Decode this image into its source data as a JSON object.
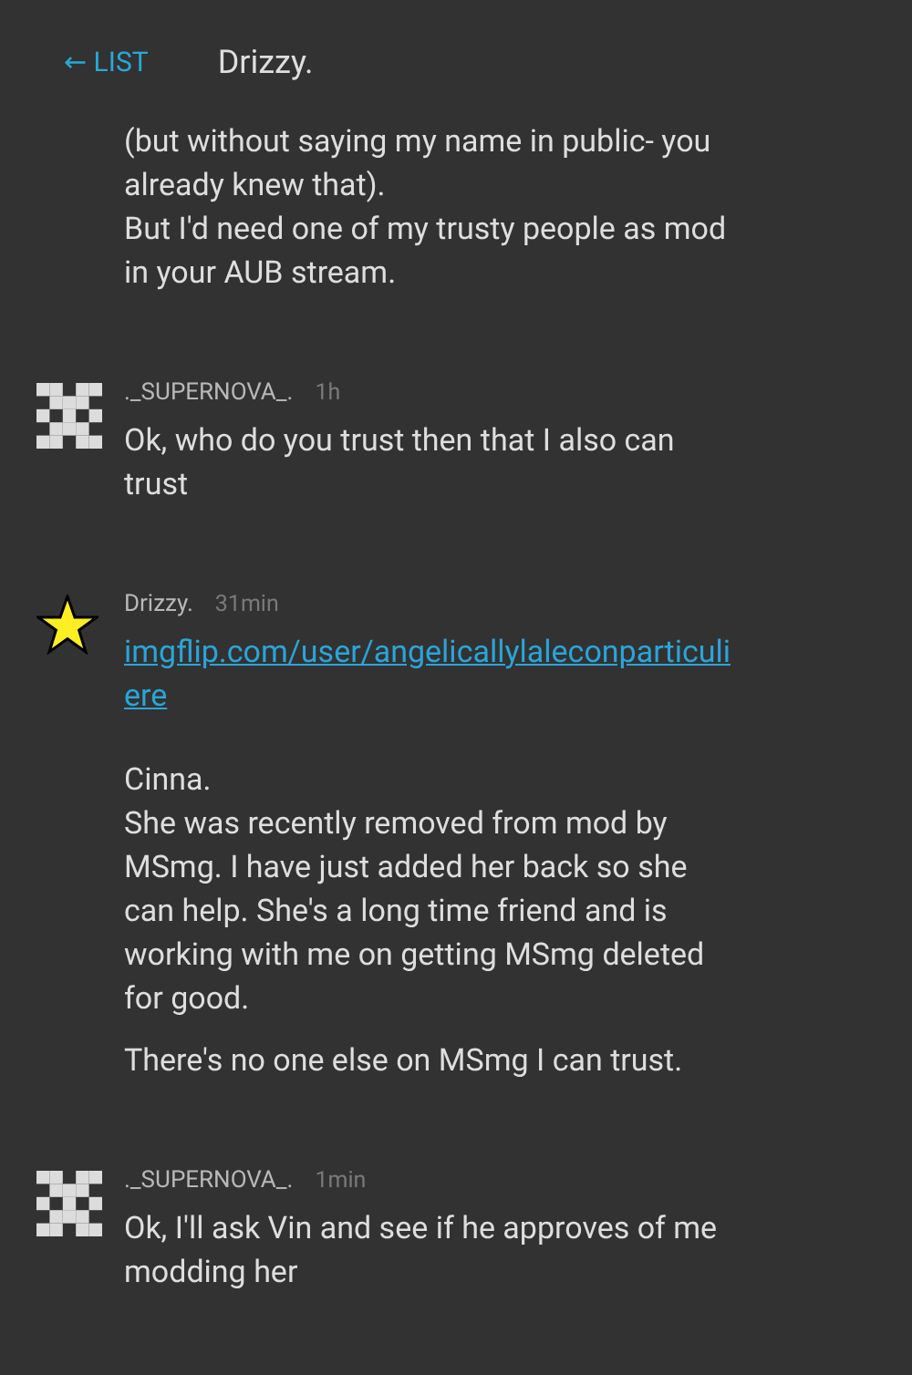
{
  "header": {
    "back_label": "← LIST",
    "title": "Drizzy."
  },
  "messages": [
    {
      "paragraphs": [
        {
          "kind": "text",
          "lines": [
            "(but without saying my name in public- you",
            "already knew that).",
            "But I'd need one of my trusty people as mod",
            "in your AUB stream."
          ]
        }
      ]
    },
    {
      "kind": "identicon",
      "author": "._SUPERNOVA_.",
      "time": "1h",
      "paragraphs": [
        {
          "kind": "text",
          "lines": [
            "Ok, who do you trust then that I also can",
            "trust"
          ]
        }
      ]
    },
    {
      "kind": "star",
      "author": "Drizzy.",
      "time": "31min",
      "paragraphs": [
        {
          "kind": "link",
          "lines": [
            "imgflip.com/user/angelicallylaleconparticuli",
            "ere"
          ]
        },
        {
          "kind": "text",
          "lines": [
            "Cinna.",
            "She was recently removed from mod by",
            "MSmg. I have just added her back so she",
            "can help. She's a long time friend and is",
            "working with me on getting MSmg deleted",
            "for good."
          ]
        },
        {
          "kind": "text",
          "lines": [
            "There's no one else on MSmg I can trust."
          ]
        }
      ]
    },
    {
      "kind": "identicon",
      "author": "._SUPERNOVA_.",
      "time": "1min",
      "paragraphs": [
        {
          "kind": "text",
          "lines": [
            "Ok, I'll ask Vin and see if he approves of me",
            "modding her"
          ]
        }
      ]
    }
  ]
}
